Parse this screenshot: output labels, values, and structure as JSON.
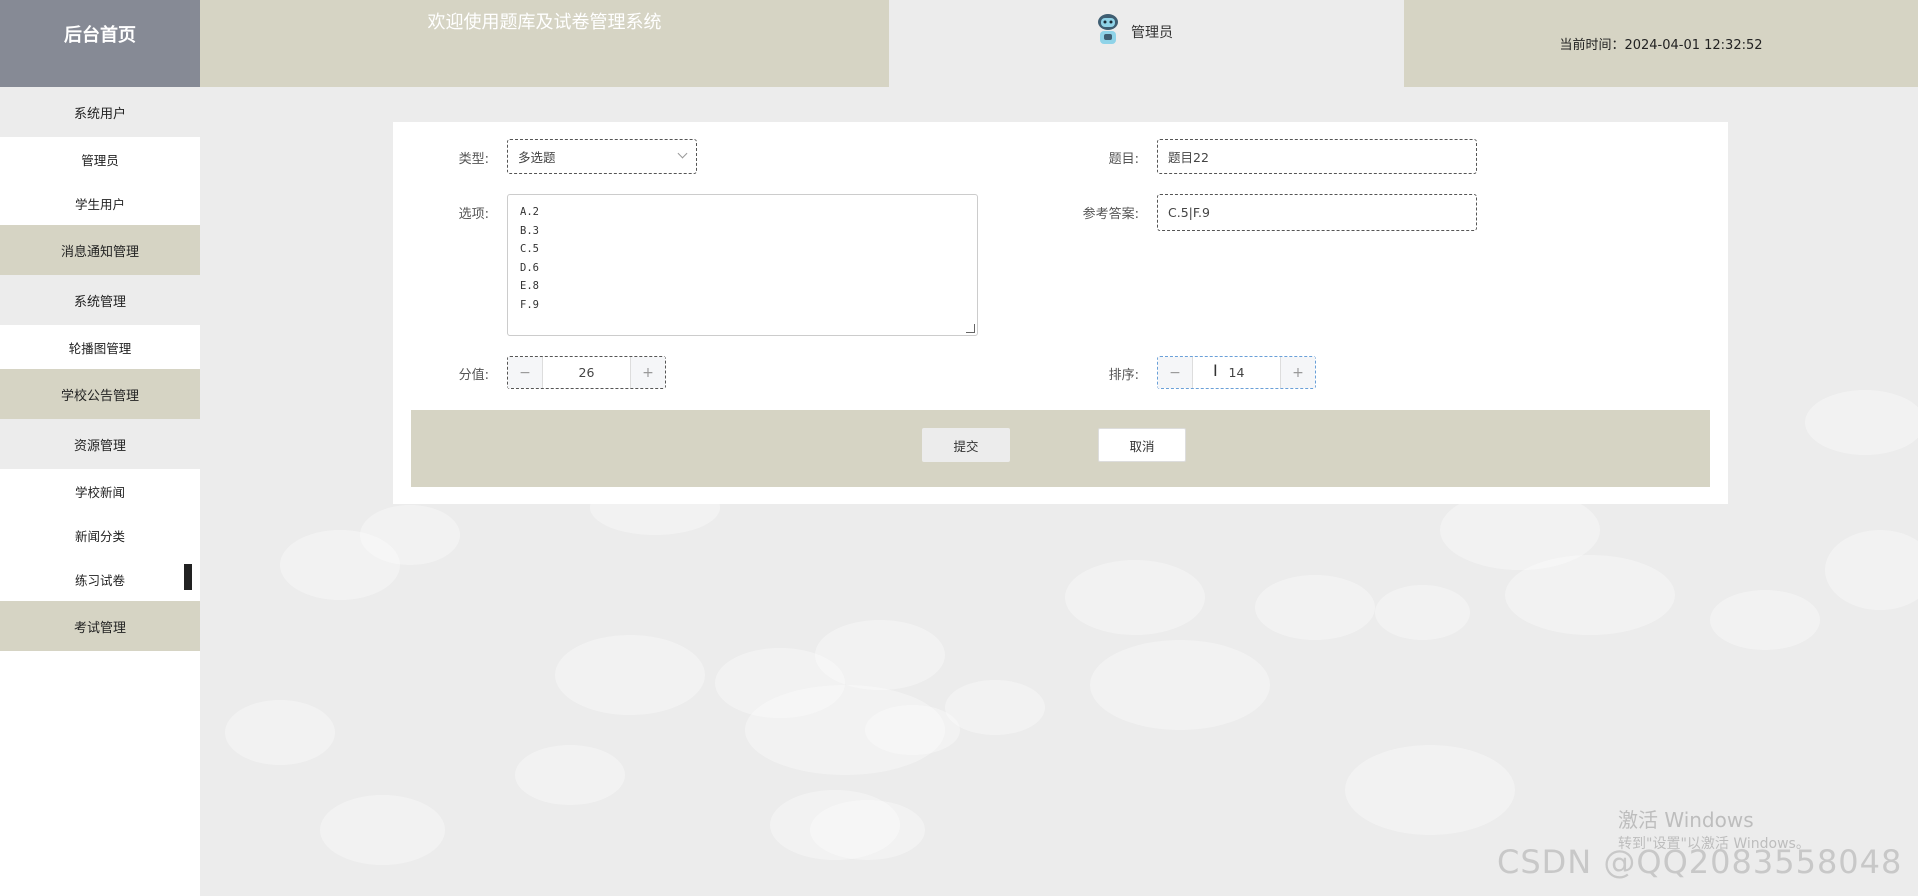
{
  "header": {
    "home_label": "后台首页",
    "welcome": "欢迎使用题库及试卷管理系统",
    "user_name": "管理员",
    "current_time": "当前时间：2024-04-01 12:32:52"
  },
  "sidebar": {
    "items": [
      {
        "label": "系统用户"
      },
      {
        "label": "管理员"
      },
      {
        "label": "学生用户"
      },
      {
        "label": "消息通知管理"
      },
      {
        "label": "系统管理"
      },
      {
        "label": "轮播图管理"
      },
      {
        "label": "学校公告管理"
      },
      {
        "label": "资源管理"
      },
      {
        "label": "学校新闻"
      },
      {
        "label": "新闻分类"
      },
      {
        "label": "练习试卷"
      },
      {
        "label": "考试管理"
      }
    ]
  },
  "form": {
    "type_label": "类型:",
    "type_value": "多选题",
    "title_label": "题目:",
    "title_value": "题目22",
    "options_label": "选项:",
    "options_lines": [
      "A.2",
      "B.3",
      "C.5",
      "D.6",
      "E.8",
      "F.9"
    ],
    "answer_label": "参考答案:",
    "answer_value": "C.5|F.9",
    "score_label": "分值:",
    "score_value": "26",
    "order_label": "排序:",
    "order_value": "14",
    "minus": "−",
    "plus": "+",
    "submit_label": "提交",
    "cancel_label": "取消"
  },
  "watermarks": {
    "windows_title": "激活 Windows",
    "windows_sub": "转到\"设置\"以激活 Windows。",
    "csdn": "CSDN @QQ2083558048"
  },
  "colors": {
    "beige": "#d6d4c4",
    "sidebar_gray": "#ececec",
    "home_bg": "#868a95"
  }
}
